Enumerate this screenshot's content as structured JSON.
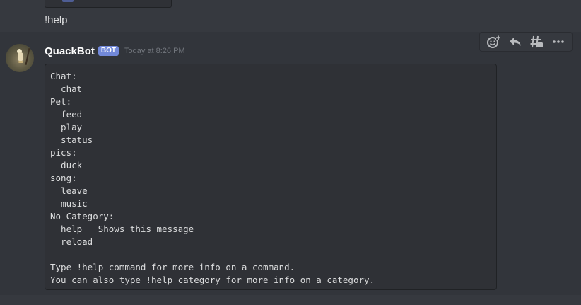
{
  "previous_message": {
    "text": "!help"
  },
  "message": {
    "username": "QuackBot",
    "bot_tag": "BOT",
    "timestamp": "Today at 8:26 PM",
    "code_text": "Chat:\n  chat\nPet:\n  feed\n  play\n  status\npics:\n  duck\nsong:\n  leave\n  music\nNo Category:\n  help   Shows this message\n  reload\n\nType !help command for more info on a command.\nYou can also type !help category for more info on a category."
  },
  "toolbar": {
    "icons": [
      "add-reaction-icon",
      "reply-icon",
      "thread-icon",
      "more-icon"
    ]
  },
  "colors": {
    "background": "#36393f",
    "hover_background": "#32353b",
    "codeblock_background": "#2f3136",
    "bot_tag": "#7289da",
    "username": "#ffffff",
    "text": "#dcddde",
    "muted": "#72767d"
  }
}
